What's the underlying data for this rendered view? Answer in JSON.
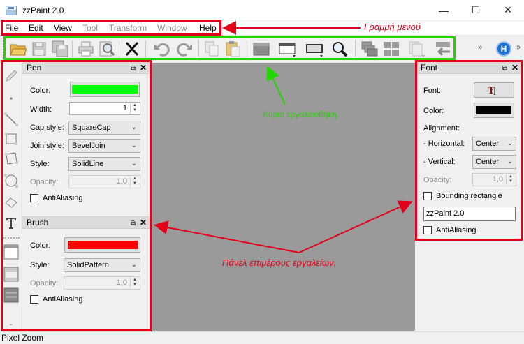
{
  "window": {
    "title": "zzPaint 2.0",
    "minimize": "—",
    "maximize": "☐",
    "close": "✕"
  },
  "menu": {
    "items": [
      "File",
      "Edit",
      "View",
      "Tool",
      "Transform",
      "Window",
      "Help"
    ],
    "disabled": [
      "Tool",
      "Transform",
      "Window"
    ]
  },
  "toolbar": {
    "overflow_left": "»",
    "overflow_right": "»",
    "help_label": "H"
  },
  "pen_panel": {
    "title": "Pen",
    "color_label": "Color:",
    "color_value": "#00ff00",
    "width_label": "Width:",
    "width_value": "1",
    "cap_label": "Cap style:",
    "cap_value": "SquareCap",
    "join_label": "Join style:",
    "join_value": "BevelJoin",
    "style_label": "Style:",
    "style_value": "SolidLine",
    "opacity_label": "Opacity:",
    "opacity_value": "1,0",
    "antialias_label": "AntiAliasing"
  },
  "brush_panel": {
    "title": "Brush",
    "color_label": "Color:",
    "color_value": "#ff0000",
    "style_label": "Style:",
    "style_value": "SolidPattern",
    "opacity_label": "Opacity:",
    "opacity_value": "1,0",
    "antialias_label": "AntiAliasing"
  },
  "font_panel": {
    "title": "Font",
    "font_label": "Font:",
    "color_label": "Color:",
    "color_value": "#000000",
    "alignment_label": "Alignment:",
    "horizontal_label": "- Horizontal:",
    "horizontal_value": "Center",
    "vertical_label": "- Vertical:",
    "vertical_value": "Center",
    "opacity_label": "Opacity:",
    "opacity_value": "1,0",
    "bounding_label": "Bounding rectangle",
    "text_value": "zzPaint 2.0",
    "antialias_label": "AntiAliasing"
  },
  "status": {
    "text": "Pixel Zoom"
  },
  "annotations": {
    "menu_bar": "Γραμμή μενού",
    "toolbar": "Κύρια εργαλειοθήκη.",
    "panels": "Πάνελ επιμέρους εργαλείων."
  },
  "colors": {
    "annotation_red": "#e3001b",
    "annotation_green": "#22d400",
    "canvas": "#9a9a9a"
  }
}
